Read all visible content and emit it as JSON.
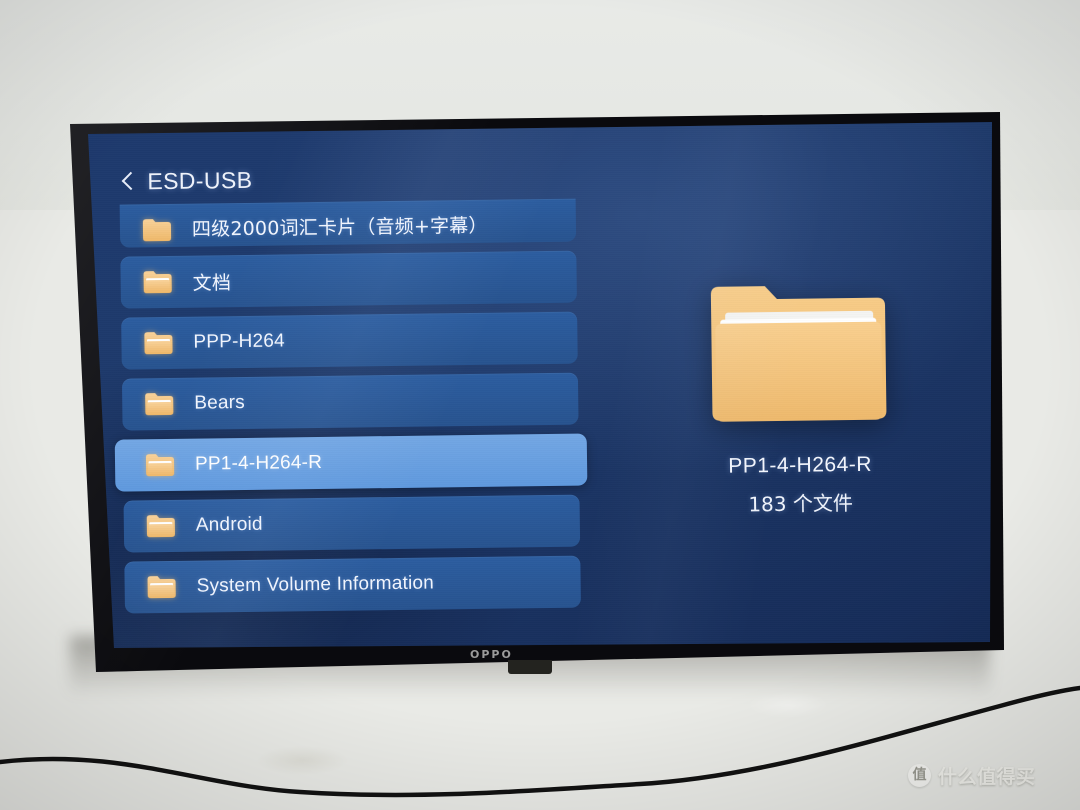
{
  "photo": {
    "device_brand": "OPPO",
    "watermark": {
      "badge": "值",
      "text": "什么值得买"
    }
  },
  "screen": {
    "header": {
      "back_icon": "chevron-left-icon",
      "title": "ESD-USB"
    },
    "file_list": [
      {
        "label": "四级2000词汇卡片（音频+字幕）",
        "icon": "folder-icon",
        "selected": false,
        "clipped": true,
        "cjk": true
      },
      {
        "label": "文档",
        "icon": "folder-icon",
        "selected": false,
        "clipped": false,
        "cjk": true
      },
      {
        "label": "PPP-H264",
        "icon": "folder-icon",
        "selected": false,
        "clipped": false,
        "cjk": false
      },
      {
        "label": "Bears",
        "icon": "folder-icon",
        "selected": false,
        "clipped": false,
        "cjk": false
      },
      {
        "label": "PP1-4-H264-R",
        "icon": "folder-icon",
        "selected": true,
        "clipped": false,
        "cjk": false
      },
      {
        "label": "Android",
        "icon": "folder-icon",
        "selected": false,
        "clipped": false,
        "cjk": false
      },
      {
        "label": "System Volume Information",
        "icon": "folder-icon",
        "selected": false,
        "clipped": false,
        "cjk": false
      }
    ],
    "preview": {
      "icon": "large-folder-icon",
      "title": "PP1-4-H264-R",
      "count": "183 个文件"
    },
    "colors": {
      "background": "#1d3a6e",
      "row": "#2c5da0",
      "row_selected": "#6b9fe0",
      "folder": "#f5c173",
      "text": "#f2f6fe"
    }
  }
}
